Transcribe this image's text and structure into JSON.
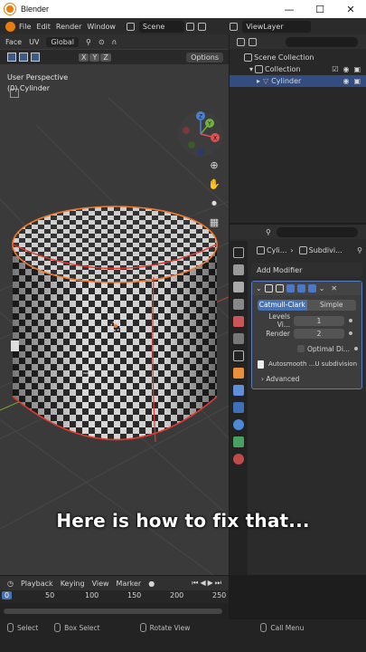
{
  "window": {
    "title": "Blender",
    "controls": [
      "—",
      "☐",
      "✕"
    ]
  },
  "topbar": {
    "menus": [
      "File",
      "Edit",
      "Render",
      "Window"
    ],
    "scene_label": "Scene",
    "viewlayer_label": "ViewLayer"
  },
  "viewport": {
    "header": {
      "mode": "Face",
      "uv": "UV",
      "orientation": "Global"
    },
    "tools": {
      "axes": [
        "X",
        "Y",
        "Z"
      ],
      "options_label": "Options"
    },
    "info": {
      "view": "User Perspective",
      "object": "(0) Cylinder"
    },
    "gizmo_axes": [
      "X",
      "Y",
      "Z"
    ],
    "caption": "Here is how to fix that..."
  },
  "outliner": {
    "rows": [
      {
        "label": "Scene Collection"
      },
      {
        "label": "Collection"
      },
      {
        "label": "Cylinder"
      }
    ]
  },
  "properties": {
    "breadcrumb": [
      "Cyli...",
      "Subdivi..."
    ],
    "add_modifier": "Add Modifier",
    "modifier": {
      "algorithm_options": [
        "Catmull-Clark",
        "Simple"
      ],
      "selected_algorithm": "Catmull-Clark",
      "levels_label": "Levels Vi...",
      "levels_value": "1",
      "render_label": "Render",
      "render_value": "2",
      "optimal_display": "Optimal Di...",
      "autosmooth_note": "Autosmooth ...U subdivision",
      "advanced_label": "Advanced"
    }
  },
  "timeline": {
    "playback": "Playback",
    "keying": "Keying",
    "view": "View",
    "marker": "Marker",
    "current_frame": "0",
    "ticks": [
      "50",
      "100",
      "150",
      "200",
      "250"
    ]
  },
  "statusbar": {
    "items": [
      "Select",
      "Box Select",
      "Rotate View",
      "Call Menu"
    ]
  },
  "colors": {
    "accent_blue": "#4772b3",
    "blender_orange": "#e87d0d",
    "edge_red": "#e03a2e",
    "edge_orange": "#f07a30"
  }
}
